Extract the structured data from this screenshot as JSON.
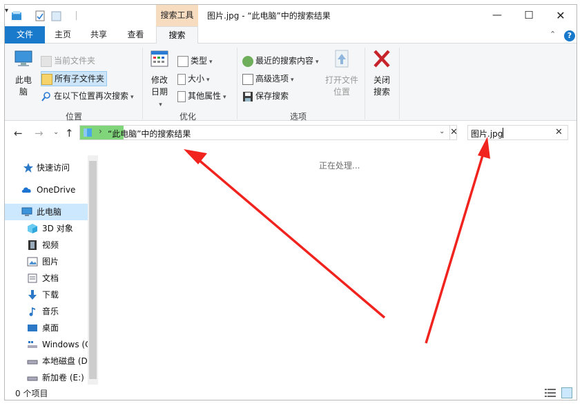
{
  "title_bar": {
    "contextual_tab": "搜索工具",
    "window_title": "图片.jpg - “此电脑”中的搜索结果",
    "dropdown_glyph": "▾",
    "minimize": "—",
    "maximize": "☐",
    "close": "✕"
  },
  "ribbon_tabs": {
    "file": "文件",
    "home": "主页",
    "share": "共享",
    "view": "查看",
    "search": "搜索",
    "collapse_glyph": "⌃",
    "help_glyph": "?"
  },
  "ribbon": {
    "location": {
      "this_pc": "此电脑",
      "current_folder": "当前文件夹",
      "all_subfolders": "所有子文件夹",
      "search_again_in": "在以下位置再次搜索",
      "label": "位置"
    },
    "refine": {
      "date_modified": "修改日期",
      "kind": "类型",
      "size": "大小",
      "other_properties": "其他属性",
      "label": "优化"
    },
    "options": {
      "recent_searches": "最近的搜索内容",
      "advanced_options": "高级选项",
      "save_search": "保存搜索",
      "open_file_location": "打开文件位置",
      "label": "选项"
    },
    "close_search": "关闭搜索",
    "dropdown_glyph": "▾"
  },
  "navigation": {
    "back": "←",
    "forward": "→",
    "recent": "⌄",
    "up": "↑",
    "address_chevron": "›",
    "address_text": "“此电脑”中的搜索结果",
    "address_dropdown": "⌄",
    "address_clear": "✕",
    "search_value": "图片.jpg",
    "search_clear": "✕"
  },
  "sidebar": {
    "items": [
      {
        "label": "快速访问",
        "icon": "star-icon"
      },
      {
        "label": "OneDrive",
        "icon": "cloud-icon"
      },
      {
        "label": "此电脑",
        "icon": "computer-icon"
      },
      {
        "label": "3D 对象",
        "icon": "cube-icon"
      },
      {
        "label": "视频",
        "icon": "film-icon"
      },
      {
        "label": "图片",
        "icon": "picture-icon"
      },
      {
        "label": "文档",
        "icon": "document-icon"
      },
      {
        "label": "下载",
        "icon": "download-icon"
      },
      {
        "label": "音乐",
        "icon": "music-icon"
      },
      {
        "label": "桌面",
        "icon": "desktop-icon"
      },
      {
        "label": "Windows (C",
        "icon": "windows-drive-icon"
      },
      {
        "label": "本地磁盘 (D",
        "icon": "drive-icon"
      },
      {
        "label": "新加卷 (E:)",
        "icon": "drive-icon"
      }
    ]
  },
  "content": {
    "status_message": "正在处理..."
  },
  "status_bar": {
    "item_count": "0 个项目"
  },
  "colors": {
    "file_tab": "#1979ca",
    "contextual_tab": "#f7dcc0",
    "selection": "#cce8ff",
    "address_highlight": "#80d47a",
    "annotation_arrow": "#f0231e"
  }
}
